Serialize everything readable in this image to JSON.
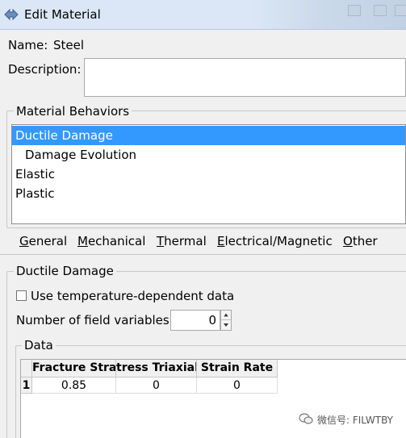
{
  "window": {
    "title": "Edit Material"
  },
  "name": {
    "label": "Name:",
    "value": "Steel"
  },
  "description": {
    "label": "Description:",
    "value": ""
  },
  "behaviors": {
    "title": "Material Behaviors",
    "items": [
      {
        "label": "Ductile Damage",
        "indent": 0,
        "selected": true
      },
      {
        "label": "Damage Evolution",
        "indent": 1,
        "selected": false
      },
      {
        "label": "Elastic",
        "indent": 0,
        "selected": false
      },
      {
        "label": "Plastic",
        "indent": 0,
        "selected": false
      }
    ]
  },
  "menu": {
    "items": [
      {
        "mnemonic": "G",
        "rest": "eneral"
      },
      {
        "mnemonic": "M",
        "rest": "echanical"
      },
      {
        "mnemonic": "T",
        "rest": "hermal"
      },
      {
        "mnemonic": "E",
        "rest": "lectrical/Magnetic"
      },
      {
        "mnemonic": "O",
        "rest": "ther"
      }
    ]
  },
  "section": {
    "title": "Ductile Damage",
    "temp_dependent_label": "Use temperature-dependent data",
    "temp_dependent_checked": false,
    "field_vars_label": "Number of field variables:",
    "field_vars_value": "0"
  },
  "data": {
    "title": "Data",
    "columns": [
      "Fracture Strain",
      "Stress Triaxiality",
      "Strain Rate"
    ],
    "columns_visible": [
      "Fracture Strai",
      "tress Triaxialit",
      "Strain Rate"
    ],
    "rows": [
      {
        "num": "1",
        "cells": [
          "0.85",
          "0",
          "0"
        ]
      }
    ]
  },
  "watermark": {
    "text": "微信号: FILWTBY"
  },
  "colors": {
    "selection": "#3399ff",
    "titlebar": "#dbe7f6"
  }
}
